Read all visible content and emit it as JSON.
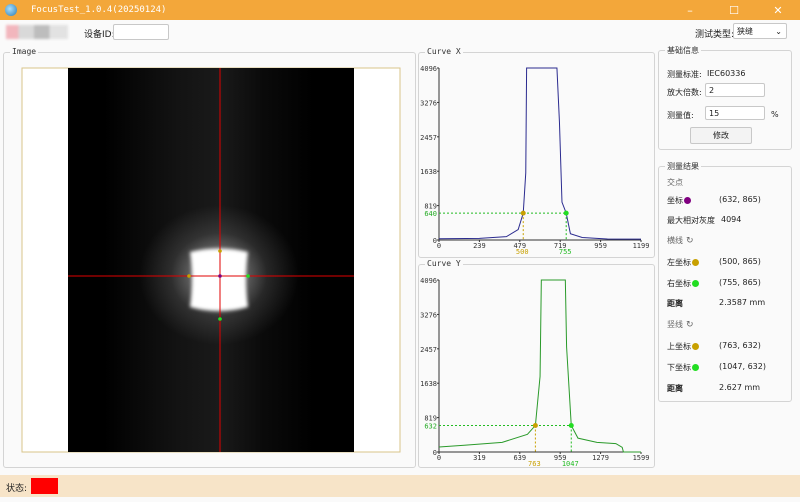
{
  "window": {
    "title": "FocusTest_1.0.4(20250124)"
  },
  "toolbar": {
    "device_id_label": "设备ID:",
    "device_id_value": "",
    "test_type_label": "测试类型:",
    "test_type_value": "狭缝"
  },
  "image_panel": {
    "title": "Image"
  },
  "curve_x": {
    "title": "Curve X",
    "y_ticks": [
      "4096",
      "3276",
      "2457",
      "1638",
      "819",
      "0"
    ],
    "x_ticks": [
      "0",
      "239",
      "479",
      "719",
      "959",
      "1199"
    ],
    "left_marker": "500",
    "right_marker": "755",
    "level_label": "640"
  },
  "curve_y": {
    "title": "Curve Y",
    "y_ticks": [
      "4096",
      "3276",
      "2457",
      "1638",
      "819",
      "0"
    ],
    "x_ticks": [
      "0",
      "319",
      "639",
      "959",
      "1279",
      "1599"
    ],
    "left_marker": "763",
    "right_marker": "1047",
    "level_label": "632"
  },
  "basic_info": {
    "title": "基础信息",
    "standard_label": "测量标准:",
    "standard_value": "IEC60336",
    "magnification_label": "放大倍数:",
    "magnification_value": "2",
    "measure_label": "测量值:",
    "measure_value": "15",
    "measure_unit": "%",
    "modify_button": "修改"
  },
  "results": {
    "title": "测量结果",
    "intersection_label": "交点",
    "coord_label": "坐标",
    "coord_value": "(632, 865)",
    "max_gray_label": "最大相对灰度",
    "max_gray_value": "4094",
    "h_line_label": "横线",
    "left_coord_label": "左坐标",
    "left_coord_value": "(500, 865)",
    "right_coord_label": "右坐标",
    "right_coord_value": "(755, 865)",
    "h_distance_label": "距离",
    "h_distance_value": "2.3587 mm",
    "v_line_label": "竖线",
    "top_coord_label": "上坐标",
    "top_coord_value": "(763, 632)",
    "bottom_coord_label": "下坐标",
    "bottom_coord_value": "(1047, 632)",
    "v_distance_label": "距离",
    "v_distance_value": "2.627 mm"
  },
  "status": {
    "label": "状态:"
  },
  "colors": {
    "titlebar": "#f3a73a",
    "curve_x": "#2b2b8f",
    "curve_y": "#2a9a2a",
    "marker_left": "#c8a000",
    "marker_right": "#22dd22",
    "crosshair": "#e00000",
    "status_bad": "#ff0000"
  },
  "chart_data": [
    {
      "type": "line",
      "title": "Curve X",
      "xlim": [
        0,
        1199
      ],
      "ylim": [
        0,
        4096
      ],
      "series": [
        {
          "values": [
            [
              0,
              30
            ],
            [
              240,
              40
            ],
            [
              400,
              80
            ],
            [
              470,
              250
            ],
            [
              500,
              640
            ],
            [
              515,
              1600
            ],
            [
              520,
              4096
            ],
            [
              530,
              4096
            ],
            [
              700,
              4096
            ],
            [
              715,
              2800
            ],
            [
              730,
              900
            ],
            [
              755,
              640
            ],
            [
              780,
              150
            ],
            [
              850,
              60
            ],
            [
              1000,
              25
            ],
            [
              1199,
              20
            ]
          ]
        }
      ]
    },
    {
      "type": "line",
      "title": "Curve Y",
      "xlim": [
        0,
        1599
      ],
      "ylim": [
        0,
        4096
      ],
      "series": [
        {
          "values": [
            [
              0,
              120
            ],
            [
              200,
              160
            ],
            [
              500,
              230
            ],
            [
              700,
              420
            ],
            [
              763,
              632
            ],
            [
              800,
              1800
            ],
            [
              810,
              4096
            ],
            [
              830,
              4096
            ],
            [
              1000,
              4096
            ],
            [
              1010,
              2500
            ],
            [
              1047,
              632
            ],
            [
              1100,
              330
            ],
            [
              1250,
              230
            ],
            [
              1400,
              200
            ],
            [
              1450,
              110
            ],
            [
              1460,
              0
            ],
            [
              1599,
              0
            ]
          ]
        }
      ]
    }
  ]
}
